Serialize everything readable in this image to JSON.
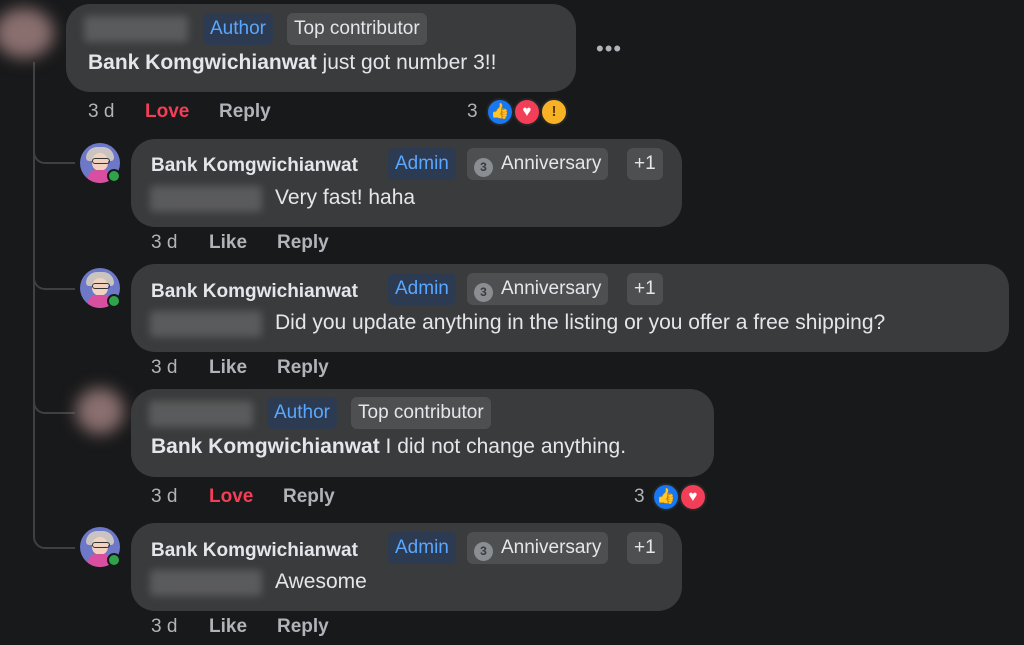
{
  "comments": [
    {
      "author_blurred": true,
      "badges": [
        "Author",
        "Top contributor"
      ],
      "mention": "Bank Komgwichianwat",
      "text": " just got number 3!!",
      "time": "3 d",
      "reaction_action": "Love",
      "reply": "Reply",
      "reaction_count": "3",
      "reactions": [
        "like",
        "love",
        "wow"
      ]
    },
    {
      "author": "Bank Komgwichianwat",
      "badges": [
        "Admin",
        "Anniversary",
        "+1"
      ],
      "anniversary_icon": "3",
      "text": "Very fast! haha",
      "time": "3 d",
      "reaction_action": "Like",
      "reply": "Reply"
    },
    {
      "author": "Bank Komgwichianwat",
      "badges": [
        "Admin",
        "Anniversary",
        "+1"
      ],
      "anniversary_icon": "3",
      "text": "Did you update anything in the listing or you offer a free shipping?",
      "time": "3 d",
      "reaction_action": "Like",
      "reply": "Reply"
    },
    {
      "author_blurred": true,
      "badges": [
        "Author",
        "Top contributor"
      ],
      "mention": "Bank Komgwichianwat",
      "text": " I did not change anything.",
      "time": "3 d",
      "reaction_action": "Love",
      "reply": "Reply",
      "reaction_count": "3",
      "reactions": [
        "like",
        "love"
      ]
    },
    {
      "author": "Bank Komgwichianwat",
      "badges": [
        "Admin",
        "Anniversary",
        "+1"
      ],
      "anniversary_icon": "3",
      "text": "Awesome",
      "time": "3 d",
      "reaction_action": "Like",
      "reply": "Reply"
    }
  ],
  "more_options": "•••",
  "colors": {
    "love": "#f33e58",
    "admin_badge": "#5aa7ff",
    "online": "#31a24c"
  }
}
